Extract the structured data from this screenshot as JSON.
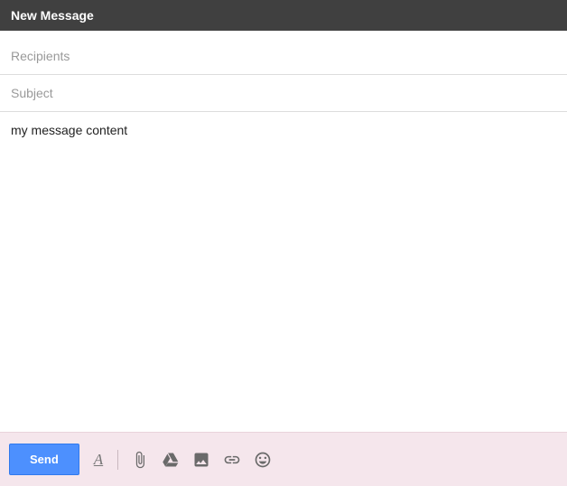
{
  "header": {
    "title": "New Message"
  },
  "fields": {
    "recipients": {
      "placeholder": "Recipients",
      "value": ""
    },
    "subject": {
      "placeholder": "Subject",
      "value": ""
    }
  },
  "body": {
    "content": "my message content"
  },
  "toolbar": {
    "send_label": "Send",
    "format_glyph": "A"
  }
}
